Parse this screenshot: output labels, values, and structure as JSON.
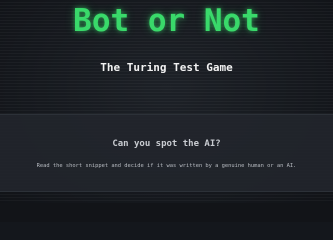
{
  "header": {
    "title": "Bot or Not",
    "subtitle": "The Turing Test Game"
  },
  "intro": {
    "heading": "Can you spot the AI?",
    "description": "Read the short snippet and decide if it was written by a genuine human or an AI."
  },
  "theme": {
    "title_color": "#39d96a",
    "background": "#14171c",
    "panel": "#22262c"
  }
}
